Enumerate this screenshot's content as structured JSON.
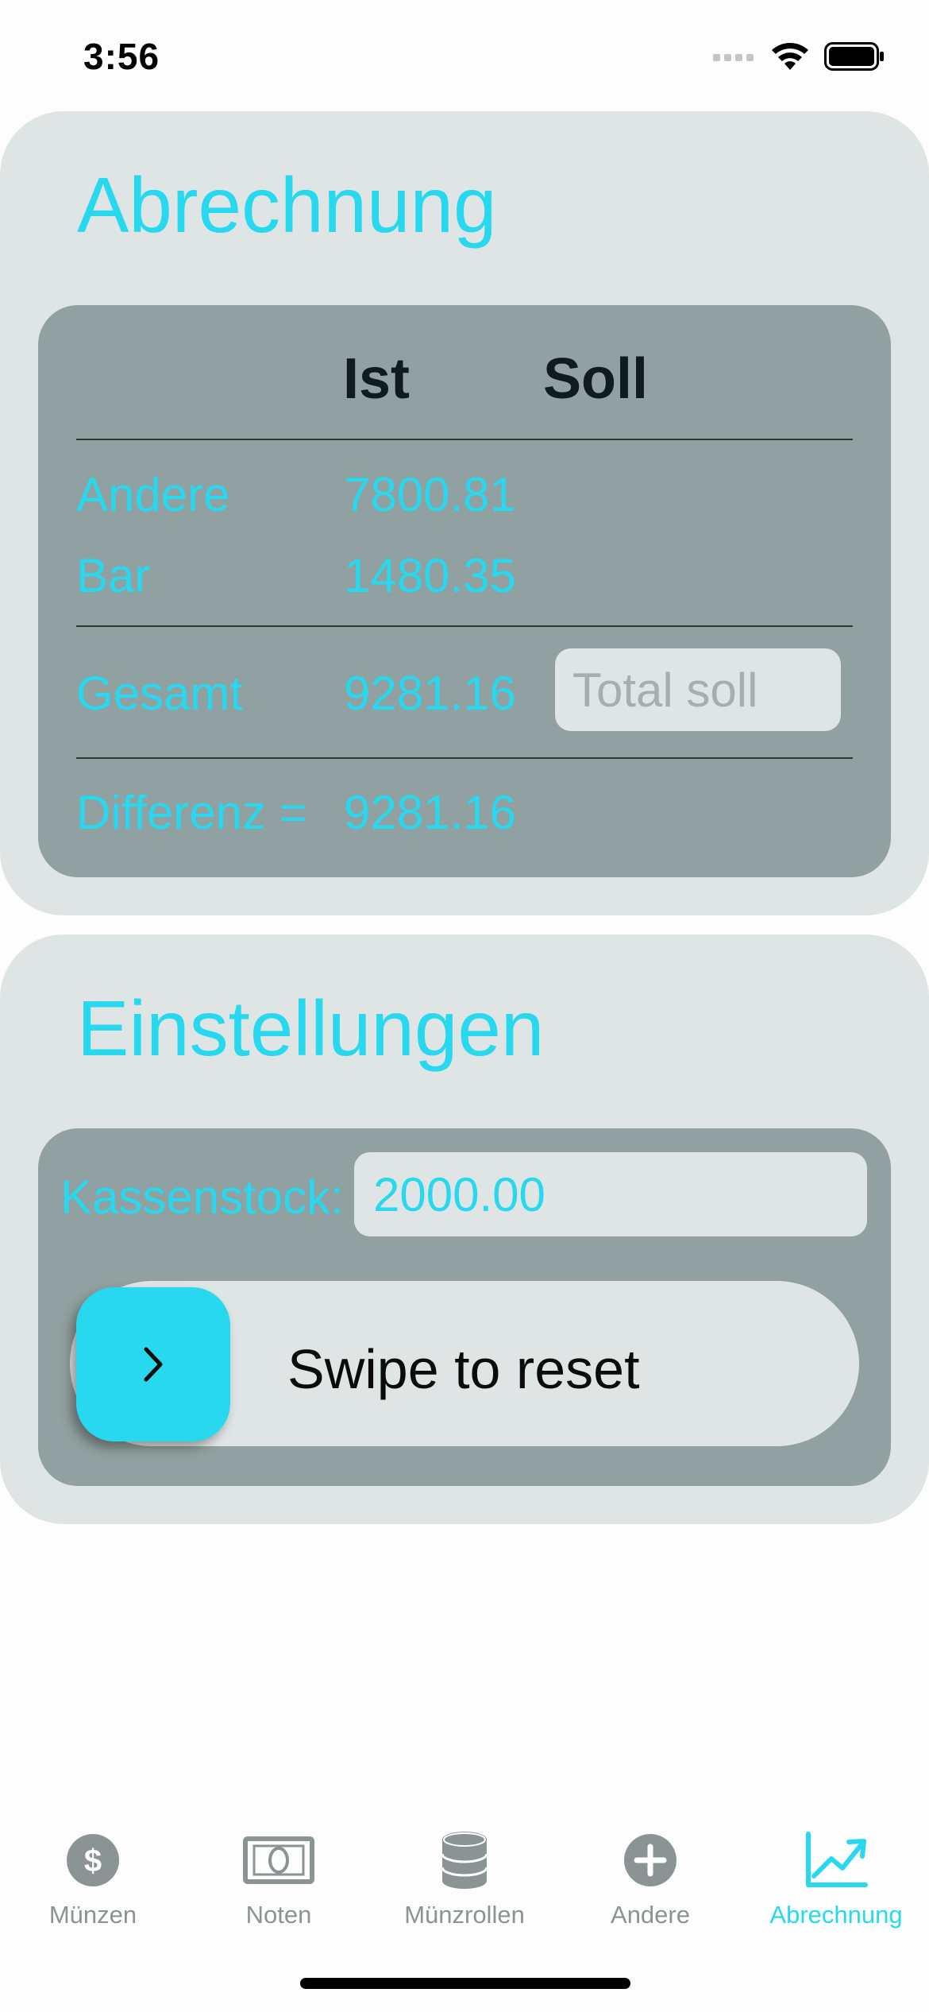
{
  "status": {
    "time": "3:56"
  },
  "abrechnung": {
    "title": "Abrechnung",
    "col_ist": "Ist",
    "col_soll": "Soll",
    "rows": [
      {
        "label": "Andere",
        "value": "7800.81"
      },
      {
        "label": "Bar",
        "value": "1480.35"
      }
    ],
    "gesamt": {
      "label": "Gesamt",
      "value": "9281.16"
    },
    "soll_placeholder": "Total soll",
    "differenz": {
      "label": "Differenz =",
      "value": "9281.16"
    }
  },
  "einstellungen": {
    "title": "Einstellungen",
    "kassenstock_label": "Kassenstock:",
    "kassenstock_value": "2000.00",
    "swipe_label": "Swipe to reset"
  },
  "tabs": [
    {
      "label": "Münzen",
      "icon": "dollar-coin-icon",
      "active": false
    },
    {
      "label": "Noten",
      "icon": "banknote-icon",
      "active": false
    },
    {
      "label": "Münzrollen",
      "icon": "coin-stack-icon",
      "active": false
    },
    {
      "label": "Andere",
      "icon": "plus-circle-icon",
      "active": false
    },
    {
      "label": "Abrechnung",
      "icon": "chart-up-icon",
      "active": true
    }
  ],
  "colors": {
    "accent": "#27d8ef",
    "card": "#dfe5e5",
    "panel": "#91a0a0",
    "tab_inactive": "#8b9495"
  }
}
